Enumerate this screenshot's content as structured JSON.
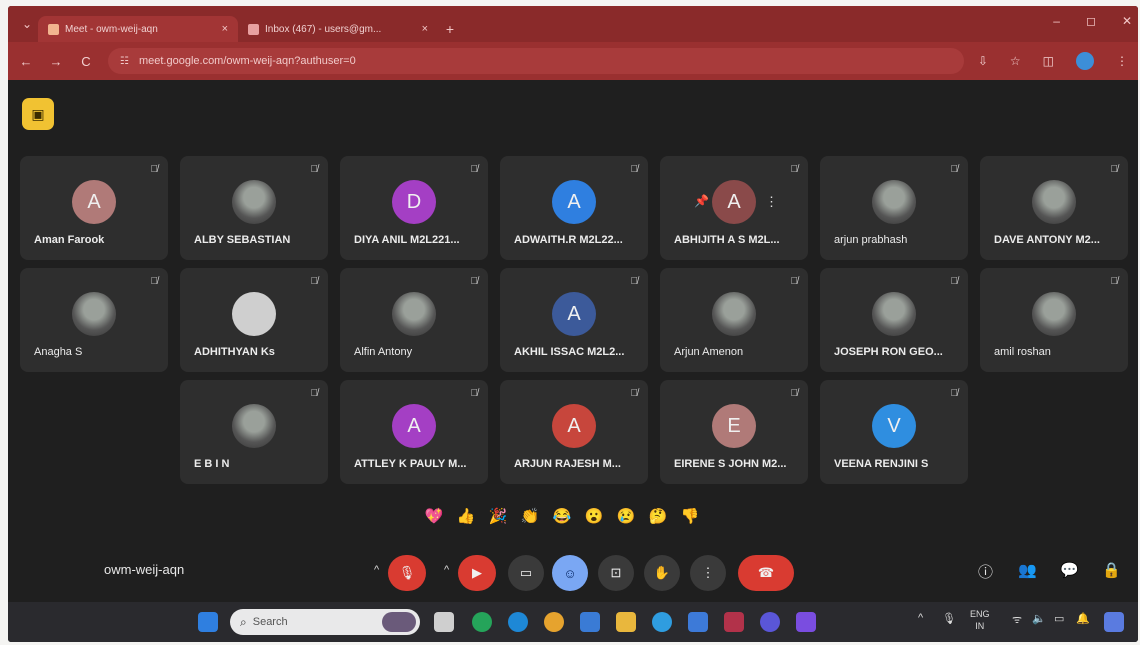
{
  "browser": {
    "tabs": [
      {
        "title": "Meet - owm-weij-aqn",
        "close": "×"
      },
      {
        "title": "Inbox (467) - users@gm...",
        "close": "×"
      }
    ],
    "new_tab": "+",
    "window_controls": {
      "minimize": "–",
      "maximize": "◻",
      "close": "✕"
    },
    "url": "meet.google.com/owm-weij-aqn?authuser=0",
    "nav": {
      "back": "←",
      "forward": "→",
      "reload": "C"
    }
  },
  "meeting": {
    "code": "owm-weij-aqn",
    "participants": [
      {
        "name": "Aman Farook",
        "initial": "A",
        "color": "#b07a78"
      },
      {
        "name": "ALBY SEBASTIAN",
        "initial": "",
        "color": "photo"
      },
      {
        "name": "DIYA ANIL M2L221...",
        "initial": "D",
        "color": "#a43fc4"
      },
      {
        "name": "ADWAITH.R M2L22...",
        "initial": "A",
        "color": "#2f7fe0"
      },
      {
        "name": "ABHIJITH A S M2L...",
        "initial": "A",
        "color": "#8a4a4a"
      },
      {
        "name": "arjun prabhash",
        "initial": "",
        "color": "photo"
      },
      {
        "name": "DAVE ANTONY M2...",
        "initial": "",
        "color": "photo"
      },
      {
        "name": "Anagha S",
        "initial": "",
        "color": "photo"
      },
      {
        "name": "ADHITHYAN Ks",
        "initial": "",
        "color": "#cfcfcf"
      },
      {
        "name": "Alfin Antony",
        "initial": "",
        "color": "photo"
      },
      {
        "name": "AKHIL ISSAC M2L2...",
        "initial": "A",
        "color": "#3c5a9a"
      },
      {
        "name": "Arjun Amenon",
        "initial": "",
        "color": "photo"
      },
      {
        "name": "JOSEPH RON GEO...",
        "initial": "",
        "color": "photo"
      },
      {
        "name": "amil roshan",
        "initial": "",
        "color": "photo"
      },
      {
        "name": "E B I N",
        "initial": "",
        "color": "photo"
      },
      {
        "name": "ATTLEY K PAULY M...",
        "initial": "A",
        "color": "#a43fc4"
      },
      {
        "name": "ARJUN RAJESH M...",
        "initial": "A",
        "color": "#c7463c"
      },
      {
        "name": "EIRENE S JOHN M2...",
        "initial": "E",
        "color": "#b07a78"
      },
      {
        "name": "VEENA RENJINI S",
        "initial": "V",
        "color": "#2f8ee0"
      }
    ],
    "reactions": [
      "💖",
      "👍",
      "🎉",
      "👏",
      "😂",
      "😮",
      "😢",
      "🤔",
      "👎"
    ]
  },
  "taskbar": {
    "search_placeholder": "Search",
    "language": "ENG",
    "region": "IN"
  }
}
